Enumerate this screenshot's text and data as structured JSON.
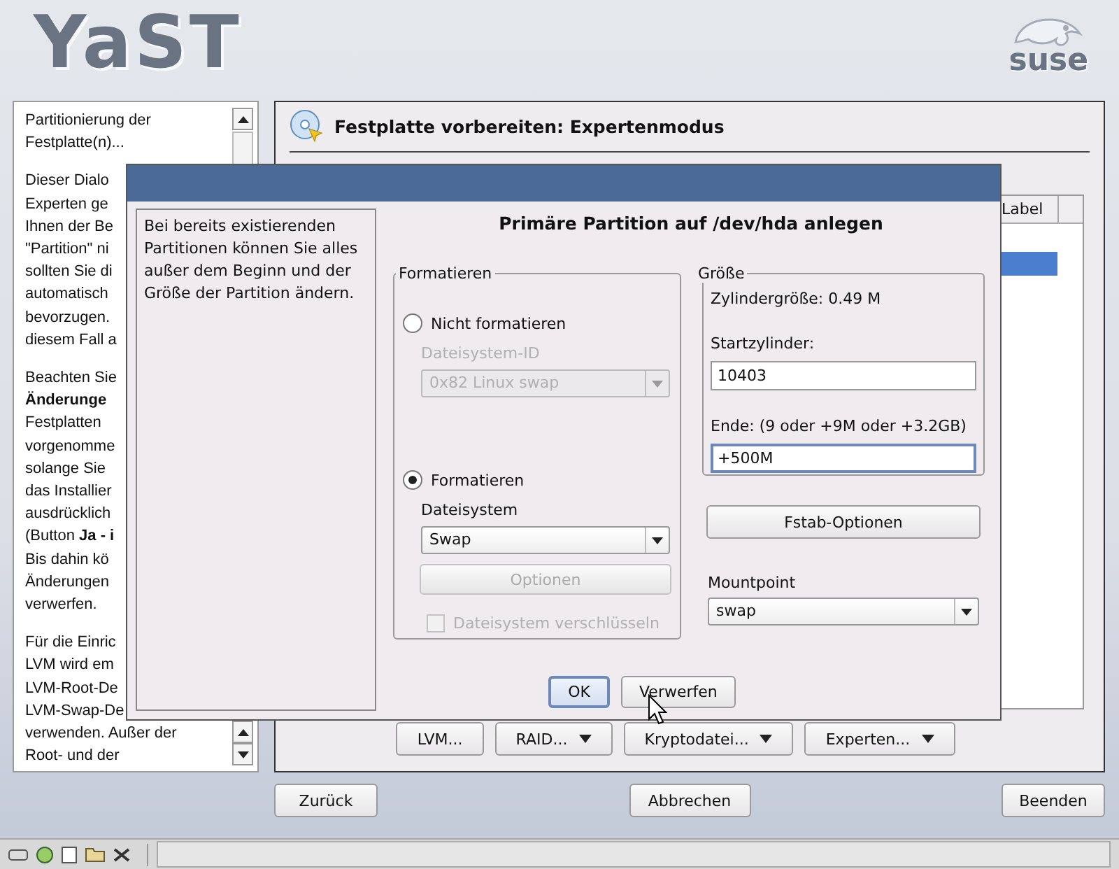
{
  "logo": {
    "text": "YaST"
  },
  "brand": {
    "text": "suse"
  },
  "help": {
    "paragraphs": [
      [
        "Partitionierung der",
        "Festplatte(n)..."
      ],
      [
        "Dieser Dialo",
        "Experten ge",
        "Ihnen der Be",
        "\"Partition\" ni",
        "sollten Sie di",
        "automatisch",
        "bevorzugen.",
        "diesem Fall a"
      ],
      [
        "Beachten Sie",
        "**Änderunge**",
        "Festplatten",
        "vorgenomme",
        "solange Sie",
        "das Installier",
        "ausdrücklich",
        "(Button **Ja - i**",
        "Bis dahin kö",
        "Änderungen",
        "verwerfen."
      ],
      [
        "Für die Einric",
        "LVM wird em",
        "LVM-Root-De",
        "LVM-Swap-De",
        "verwenden. Außer der",
        "Root- und der"
      ]
    ]
  },
  "main": {
    "title": "Festplatte vorbereiten: Expertenmodus",
    "table": {
      "columns": [
        "Label"
      ],
      "rows": [
        {
          "selected": true
        }
      ]
    },
    "buttons": [
      {
        "label": "LVM...",
        "menu": false
      },
      {
        "label": "RAID...",
        "menu": true
      },
      {
        "label": "Kryptodatei...",
        "menu": true
      },
      {
        "label": "Experten...",
        "menu": true
      }
    ]
  },
  "dialog": {
    "help": "Bei bereits existierenden Partitionen können Sie alles außer dem Beginn und der Größe der Partition ändern.",
    "heading": "Primäre Partition auf /dev/hda anlegen",
    "format_group": {
      "title": "Formatieren",
      "radios": [
        {
          "label": "Nicht formatieren",
          "selected": false
        },
        {
          "label": "Formatieren",
          "selected": true
        }
      ],
      "fs_id": {
        "label": "Dateisystem-ID",
        "value": "0x82 Linux swap",
        "disabled": true
      },
      "filesystem": {
        "label": "Dateisystem",
        "value": "Swap",
        "disabled": false
      },
      "options_button": {
        "label": "Optionen",
        "disabled": true
      },
      "encrypt": {
        "label": "Dateisystem verschlüsseln",
        "checked": false,
        "disabled": true
      }
    },
    "size_group": {
      "title": "Größe",
      "cylinder_size": "Zylindergröße: 0.49 M",
      "start": {
        "label": "Startzylinder:",
        "value": "10403",
        "focused": false
      },
      "end": {
        "label": "Ende:  (9 oder +9M oder +3.2GB)",
        "value": "+500M",
        "focused": true
      }
    },
    "fstab_button": "Fstab-Optionen",
    "mountpoint": {
      "label": "Mountpoint",
      "value": "swap"
    },
    "buttons": [
      {
        "label": "OK",
        "focused": true
      },
      {
        "label": "Verwerfen",
        "focused": false
      }
    ]
  },
  "nav": [
    {
      "label": "Zurück"
    },
    {
      "label": "Abbrechen"
    },
    {
      "label": "Beenden"
    }
  ]
}
